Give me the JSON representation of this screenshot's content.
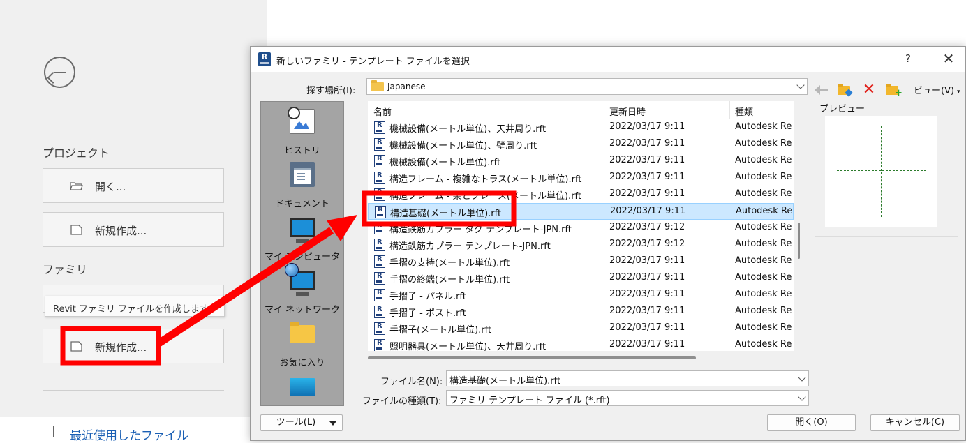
{
  "home": {
    "section_project": "プロジェクト",
    "open_label": "開く...",
    "new_project_label": "新規作成...",
    "section_family": "ファミリ",
    "tooltip": "Revit ファミリ ファイルを作成します",
    "new_family_label": "新規作成...",
    "recent_label": "最近使用したファイル"
  },
  "dialog": {
    "app_icon_text": "R",
    "title": "新しいファミリ - テンプレート ファイルを選択",
    "help_label": "?",
    "close_label": "✕",
    "look_in_label": "探す場所(I):",
    "look_in_value": "Japanese",
    "delete_icon_glyph": "✕",
    "new_folder_plus": "+",
    "view_label": "ビュー(V)",
    "view_arrow": "▾",
    "places": [
      {
        "label": "ヒストリ",
        "icon": "history-icon"
      },
      {
        "label": "ドキュメント",
        "icon": "documents-icon"
      },
      {
        "label": "マイ コンピュータ",
        "icon": "computer-icon"
      },
      {
        "label": "マイ ネットワーク",
        "icon": "network-icon"
      },
      {
        "label": "お気に入り",
        "icon": "favorites-icon"
      },
      {
        "label": "",
        "icon": "desktop-icon"
      }
    ],
    "columns": {
      "name": "名前",
      "date": "更新日時",
      "type": "種類"
    },
    "files": [
      {
        "name": "機械設備(メートル単位)、天井周り.rft",
        "date": "2022/03/17 9:11",
        "type": "Autodesk Re"
      },
      {
        "name": "機械設備(メートル単位)、壁周り.rft",
        "date": "2022/03/17 9:11",
        "type": "Autodesk Re"
      },
      {
        "name": "機械設備(メートル単位).rft",
        "date": "2022/03/17 9:11",
        "type": "Autodesk Re"
      },
      {
        "name": "構造フレーム - 複雑なトラス(メートル単位).rft",
        "date": "2022/03/17 9:11",
        "type": "Autodesk Re"
      },
      {
        "name": "構造フレーム - 梁とブレース(メートル単位).rft",
        "date": "2022/03/17 9:11",
        "type": "Autodesk Re"
      },
      {
        "name": "構造基礎(メートル単位).rft",
        "date": "2022/03/17 9:11",
        "type": "Autodesk Re",
        "selected": true
      },
      {
        "name": "構造鉄筋カプラー タグ テンプレート-JPN.rft",
        "date": "2022/03/17 9:12",
        "type": "Autodesk Re"
      },
      {
        "name": "構造鉄筋カプラー テンプレート-JPN.rft",
        "date": "2022/03/17 9:12",
        "type": "Autodesk Re"
      },
      {
        "name": "手摺の支持(メートル単位).rft",
        "date": "2022/03/17 9:11",
        "type": "Autodesk Re"
      },
      {
        "name": "手摺の終端(メートル単位).rft",
        "date": "2022/03/17 9:11",
        "type": "Autodesk Re"
      },
      {
        "name": "手摺子 - パネル.rft",
        "date": "2022/03/17 9:11",
        "type": "Autodesk Re"
      },
      {
        "name": "手摺子 - ポスト.rft",
        "date": "2022/03/17 9:11",
        "type": "Autodesk Re"
      },
      {
        "name": "手摺子(メートル単位).rft",
        "date": "2022/03/17 9:11",
        "type": "Autodesk Re"
      },
      {
        "name": "照明器具(メートル単位)、天井周り.rft",
        "date": "2022/03/17 9:11",
        "type": "Autodesk Re"
      }
    ],
    "preview_label": "プレビュー",
    "filename_label": "ファイル名(N):",
    "filename_value": "構造基礎(メートル単位).rft",
    "filetype_label": "ファイルの種類(T):",
    "filetype_value": "ファミリ テンプレート ファイル (*.rft)",
    "tools_label": "ツール(L)",
    "open_label": "開く(O)",
    "cancel_label": "キャンセル(C)"
  },
  "colors": {
    "highlight": "#ff0000",
    "selection": "#cce8ff",
    "link": "#1a5fb4"
  }
}
